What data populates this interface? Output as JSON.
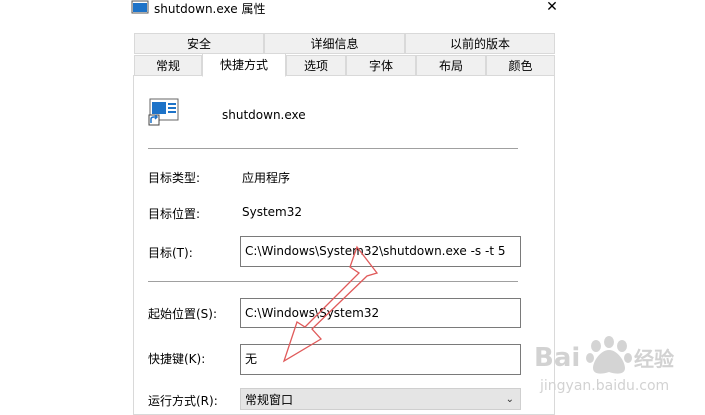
{
  "window": {
    "title": "shutdown.exe  属性",
    "close_label": "✕"
  },
  "tabs_row_top": [
    {
      "label": "安全"
    },
    {
      "label": "详细信息"
    },
    {
      "label": "以前的版本"
    }
  ],
  "tabs_row_bottom": [
    {
      "label": "常规"
    },
    {
      "label": "快捷方式",
      "active": true
    },
    {
      "label": "选项"
    },
    {
      "label": "字体"
    },
    {
      "label": "布局"
    },
    {
      "label": "颜色"
    }
  ],
  "shortcut": {
    "file_name": "shutdown.exe",
    "target_type_label": "目标类型:",
    "target_type_value": "应用程序",
    "target_location_label": "目标位置:",
    "target_location_value": "System32",
    "target_label": "目标(T):",
    "target_value": "C:\\Windows\\System32\\shutdown.exe -s -t 5",
    "start_in_label": "起始位置(S):",
    "start_in_value": "C:\\Windows\\System32",
    "hotkey_label": "快捷键(K):",
    "hotkey_value": "无",
    "run_label": "运行方式(R):",
    "run_value": "常规窗口"
  },
  "watermark": {
    "brand": "Bai",
    "brand2": "经验",
    "url": "jingyan.baidu.com"
  },
  "colors": {
    "arrow": "#e05a5a",
    "icon_blue": "#1e73c8"
  }
}
